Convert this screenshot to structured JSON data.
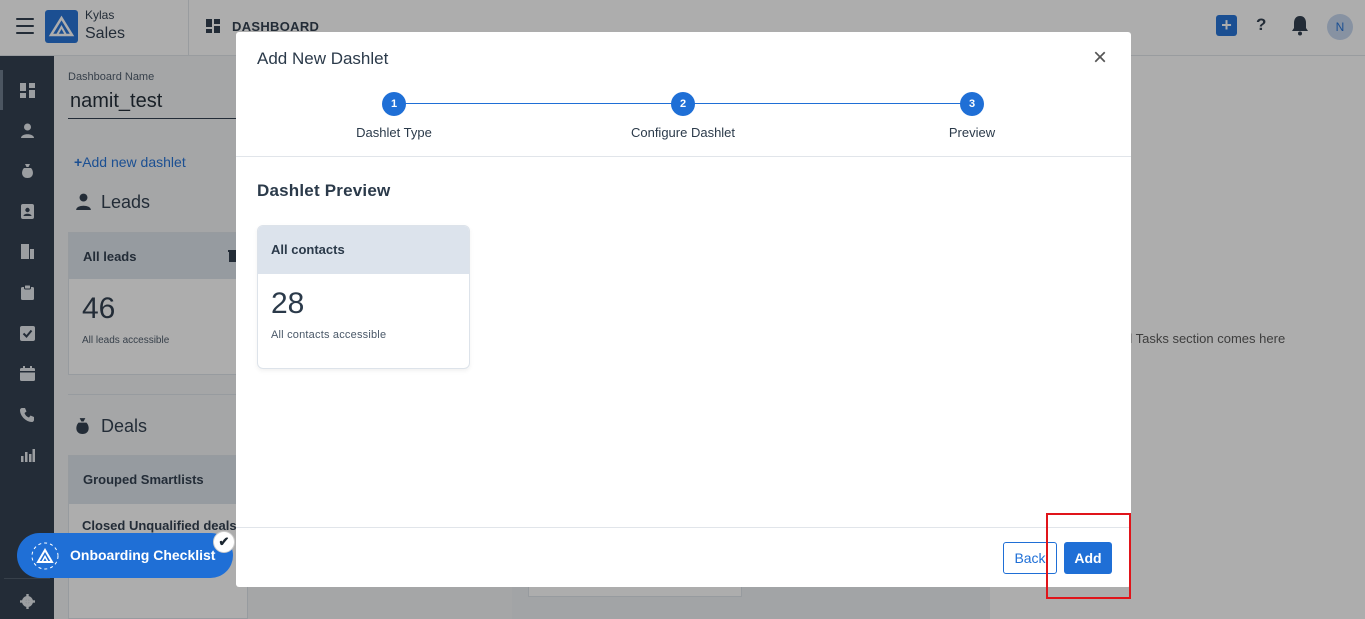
{
  "app": {
    "brand_top": "Kylas",
    "brand_main": "Sales",
    "section_title": "DASHBOARD",
    "avatar_initial": "N",
    "help_label": "?"
  },
  "background": {
    "dashboard_name_label": "Dashboard Name",
    "dashboard_name_value": "namit_test",
    "add_new_dashlet": "Add new dashlet",
    "leads_section": "Leads",
    "leads_card_title": "All leads",
    "leads_count": "46",
    "leads_caption": "All leads accessible",
    "deals_section": "Deals",
    "grouped_title": "Grouped Smartlists",
    "closed_unqualified": "Closed Unqualified deals",
    "right_placeholder": "d Tasks section comes here"
  },
  "onboarding": {
    "label": "Onboarding Checklist",
    "check": "✔"
  },
  "modal": {
    "title": "Add New Dashlet",
    "close": "×",
    "steps": [
      {
        "number": "1",
        "label": "Dashlet Type"
      },
      {
        "number": "2",
        "label": "Configure Dashlet"
      },
      {
        "number": "3",
        "label": "Preview"
      }
    ],
    "preview_title": "Dashlet Preview",
    "preview_card": {
      "title": "All contacts",
      "count": "28",
      "caption": "All contacts accessible"
    },
    "back_label": "Back",
    "add_label": "Add"
  },
  "colors": {
    "accent": "#1f6fd6",
    "sidebar": "#2b3a4a",
    "highlight": "#e0141a"
  }
}
